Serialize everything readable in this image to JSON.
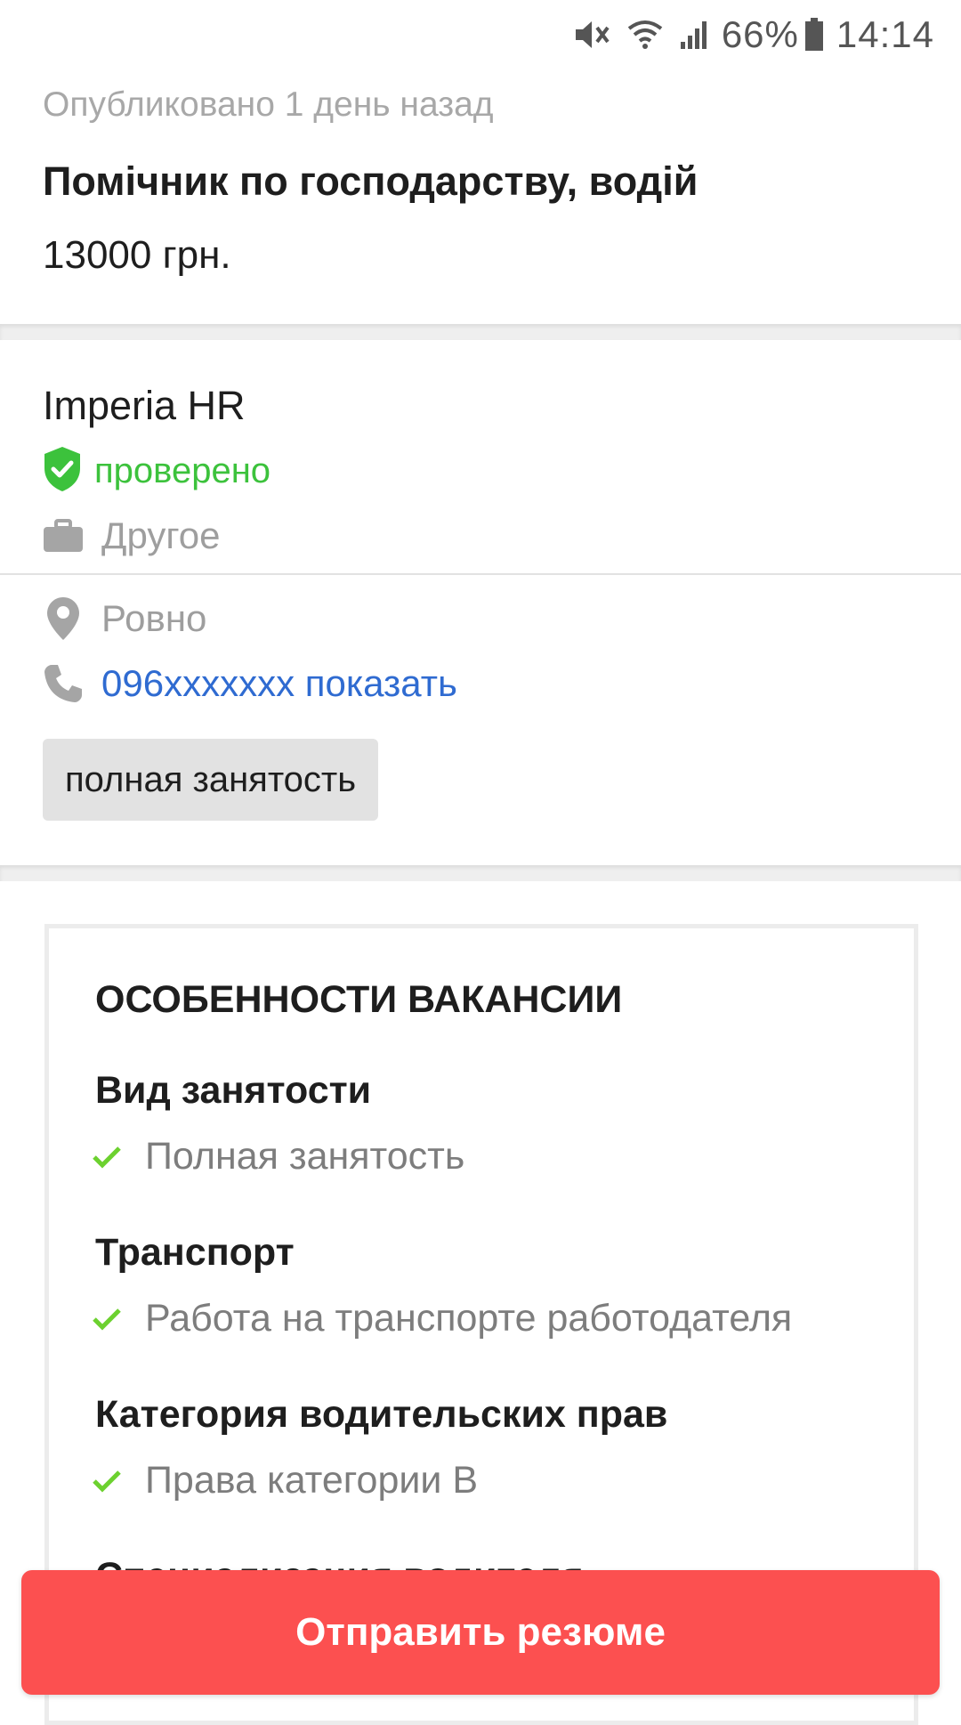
{
  "status_bar": {
    "battery": "66%",
    "time": "14:14",
    "icons": [
      "mute-icon",
      "wifi-icon",
      "signal-icon",
      "battery-icon"
    ]
  },
  "header": {
    "published": "Опубликовано 1 день назад",
    "title": "Помічник по господарству, водій",
    "salary": "13000 грн."
  },
  "company": {
    "name": "Imperia HR",
    "verified": "проверено",
    "category": "Другое",
    "city": "Ровно",
    "phone": "096xxxxxxx показать",
    "employment_tag": "полная занятость",
    "verified_color": "#3cc23c",
    "link_color": "#2f6bd1"
  },
  "features": {
    "heading": "ОСОБЕННОСТИ ВАКАНСИИ",
    "sections": [
      {
        "title": "Вид занятости",
        "item": "Полная занятость"
      },
      {
        "title": "Транспорт",
        "item": "Работа на транспорте работодателя"
      },
      {
        "title": "Категория водительских прав",
        "item": "Права категории B"
      },
      {
        "title": "Специализация водителя"
      }
    ],
    "check_color": "#6cd12f"
  },
  "cta": {
    "label": "Отправить резюме",
    "color": "#fc5050"
  }
}
